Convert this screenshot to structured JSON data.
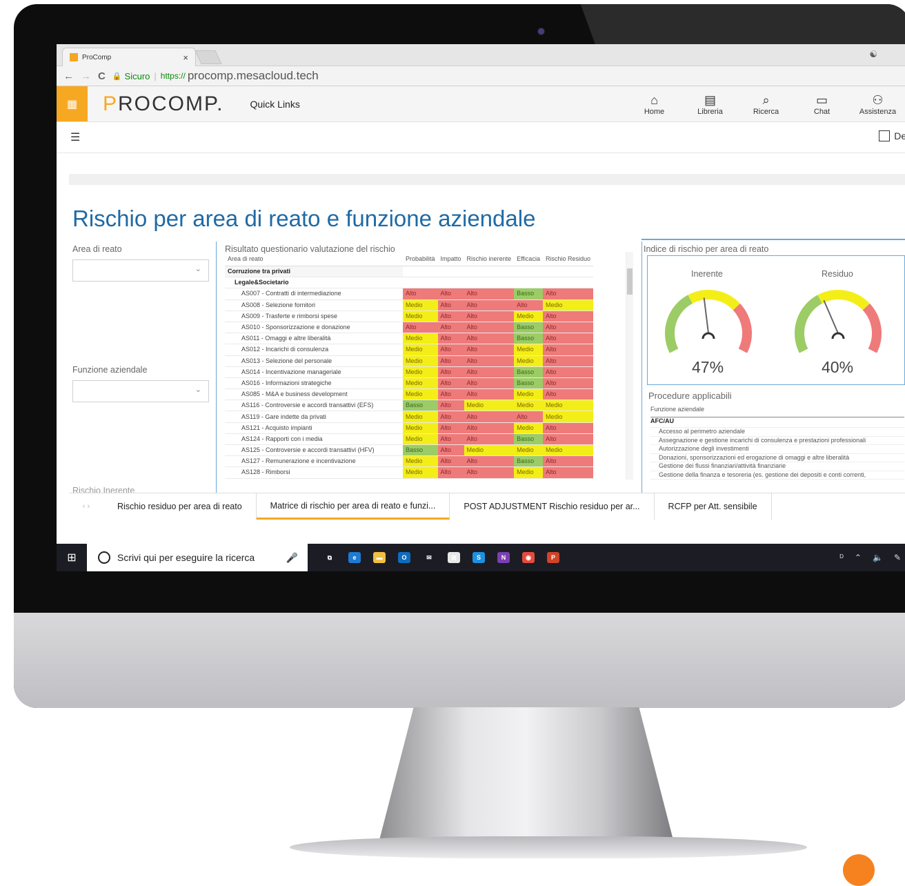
{
  "browser": {
    "tab_title": "ProComp",
    "tab_close": "×",
    "profile_icon": "user-circle-icon",
    "back": "←",
    "forward": "→",
    "reload": "C",
    "secure_label": "Sicuro",
    "url_scheme": "https://",
    "url_host": "procomp.mesacloud.tech"
  },
  "app": {
    "logo_prefix": "P",
    "logo_rest": "ROCOMP.",
    "quick_links": "Quick Links",
    "nav": [
      {
        "label": "Home",
        "icon": "home-icon",
        "glyph": "⌂"
      },
      {
        "label": "Libreria",
        "icon": "library-icon",
        "glyph": "▤"
      },
      {
        "label": "Ricerca",
        "icon": "search-icon",
        "glyph": "⌕"
      },
      {
        "label": "Chat",
        "icon": "chat-icon",
        "glyph": "▭"
      },
      {
        "label": "Assistenza",
        "icon": "support-icon",
        "glyph": "⚇"
      }
    ],
    "details_checkbox": "Det"
  },
  "report": {
    "title": "Rischio per area di reato e funzione aziendale",
    "area_label": "Area di reato",
    "funzione_label": "Funzione aziendale",
    "rischio_label": "Rischio Inerente",
    "matrix_title": "Risultato questionario valutazione del rischio",
    "columns": [
      "Area di reato",
      "Probabilità",
      "Impatto",
      "Rischio inerente",
      "Efficacia",
      "Rischio Residuo"
    ],
    "group1": "Corruzione tra privati",
    "group2": "Legale&Societario",
    "rows": [
      [
        "AS007 - Contratti di intermediazione",
        "Alto",
        "Alto",
        "Alto",
        "Basso",
        "Alto"
      ],
      [
        "AS008 - Selezione fornitori",
        "Medio",
        "Alto",
        "Alto",
        "Alto",
        "Medio"
      ],
      [
        "AS009 - Trasferte e rimborsi spese",
        "Medio",
        "Alto",
        "Alto",
        "Medio",
        "Alto"
      ],
      [
        "AS010 - Sponsorizzazione e donazione",
        "Alto",
        "Alto",
        "Alto",
        "Basso",
        "Alto"
      ],
      [
        "AS011 - Omaggi e altre liberalità",
        "Medio",
        "Alto",
        "Alto",
        "Basso",
        "Alto"
      ],
      [
        "AS012 - Incarichi di consulenza",
        "Medio",
        "Alto",
        "Alto",
        "Medio",
        "Alto"
      ],
      [
        "AS013 - Selezione del personale",
        "Medio",
        "Alto",
        "Alto",
        "Medio",
        "Alto"
      ],
      [
        "AS014 - Incentivazione manageriale",
        "Medio",
        "Alto",
        "Alto",
        "Basso",
        "Alto"
      ],
      [
        "AS016 - Informazioni strategiche",
        "Medio",
        "Alto",
        "Alto",
        "Basso",
        "Alto"
      ],
      [
        "AS085 - M&A e business development",
        "Medio",
        "Alto",
        "Alto",
        "Medio",
        "Alto"
      ],
      [
        "AS116 - Controversie e accordi transattivi (EFS)",
        "Basso",
        "Alto",
        "Medio",
        "Medio",
        "Medio"
      ],
      [
        "AS119 - Gare indette da privati",
        "Medio",
        "Alto",
        "Alto",
        "Alto",
        "Medio"
      ],
      [
        "AS121 - Acquisto impianti",
        "Medio",
        "Alto",
        "Alto",
        "Medio",
        "Alto"
      ],
      [
        "AS124 - Rapporti con i media",
        "Medio",
        "Alto",
        "Alto",
        "Basso",
        "Alto"
      ],
      [
        "AS125 - Controversie e accordi transattivi (HFV)",
        "Basso",
        "Alto",
        "Medio",
        "Medio",
        "Medio"
      ],
      [
        "AS127 - Remunerazione e incentivazione",
        "Medio",
        "Alto",
        "Alto",
        "Basso",
        "Alto"
      ],
      [
        "AS128 - Rimborsi",
        "Medio",
        "Alto",
        "Alto",
        "Medio",
        "Alto"
      ]
    ],
    "gauge_title": "Indice di rischio per area di reato",
    "gauges": [
      {
        "label": "Inerente",
        "value": "47%",
        "fraction": 0.47
      },
      {
        "label": "Residuo",
        "value": "40%",
        "fraction": 0.4
      }
    ],
    "proc_title": "Procedure applicabili",
    "proc_col": "Funzione aziendale",
    "proc_group": "AFC/AU",
    "proc_items": [
      "Accesso al perimetro aziendale",
      "Assegnazione e gestione incarichi di consulenza e prestazioni professionali",
      "Autorizzazione degli investimenti",
      "Donazioni, sponsorizzazioni ed erogazione di omaggi e altre liberalità",
      "Gestione dei flussi finanziari/attività finanziarie",
      "Gestione della finanza e tesoreria (es. gestione dei depositi e conti correnti,"
    ]
  },
  "page_tabs": [
    "Rischio residuo per area di reato",
    "Matrice di rischio per area di reato e funzi...",
    "POST ADJUSTMENT Rischio residuo per ar...",
    "RCFP per Att. sensibile"
  ],
  "taskbar": {
    "search_placeholder": "Scrivi qui per eseguire la ricerca",
    "apps": [
      {
        "name": "task-view-icon",
        "glyph": "⧉",
        "color": "#1c1c24"
      },
      {
        "name": "edge-icon",
        "glyph": "e",
        "color": "#1e7bd4"
      },
      {
        "name": "file-explorer-icon",
        "glyph": "▬",
        "color": "#f0c040"
      },
      {
        "name": "outlook-icon",
        "glyph": "O",
        "color": "#0f6cbd"
      },
      {
        "name": "mail-icon",
        "glyph": "✉",
        "color": "#1c1c24"
      },
      {
        "name": "store-icon",
        "glyph": "⊞",
        "color": "#e8e8e8"
      },
      {
        "name": "skype-icon",
        "glyph": "S",
        "color": "#1e90e0"
      },
      {
        "name": "onenote-icon",
        "glyph": "N",
        "color": "#7b3fb1"
      },
      {
        "name": "chrome-icon",
        "glyph": "◉",
        "color": "#e64a3c"
      },
      {
        "name": "powerpoint-icon",
        "glyph": "P",
        "color": "#d0442a"
      }
    ]
  },
  "colors": {
    "accent": "#f7a823",
    "alto": "#ef7a7a",
    "medio": "#f4ee18",
    "basso": "#9ccc65",
    "title_blue": "#1f6aa5"
  }
}
